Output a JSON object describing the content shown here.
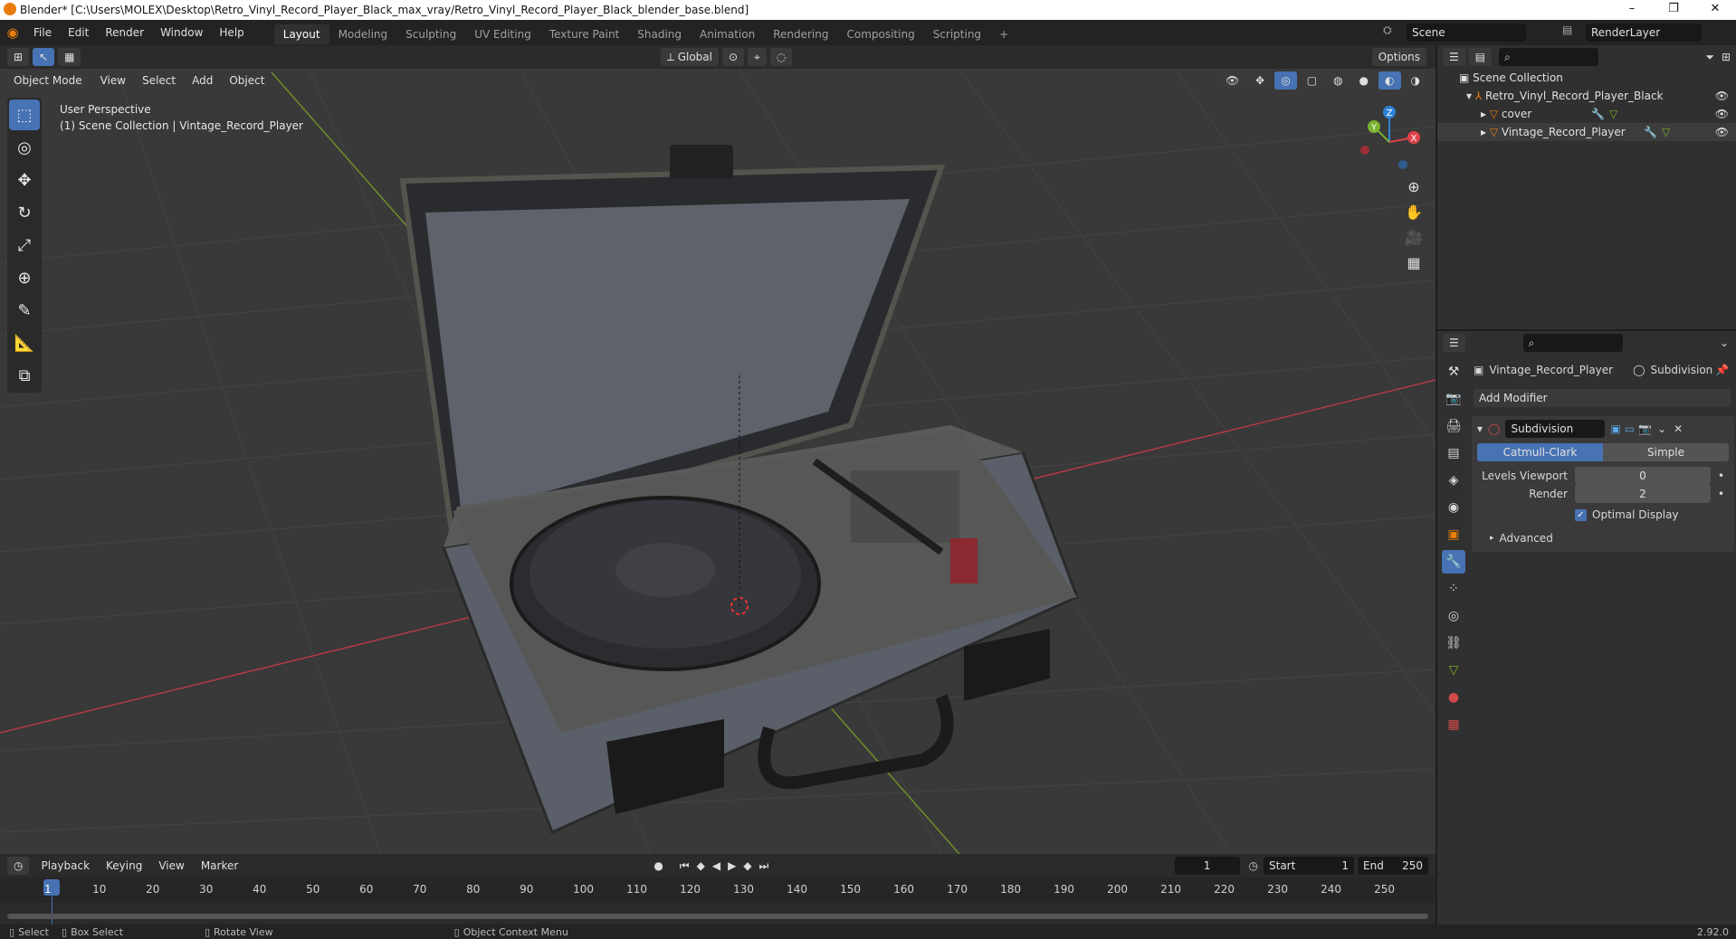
{
  "window": {
    "title": "Blender* [C:\\Users\\MOLEX\\Desktop\\Retro_Vinyl_Record_Player_Black_max_vray/Retro_Vinyl_Record_Player_Black_blender_base.blend]",
    "min_btn": "–",
    "max_btn": "❐",
    "close_btn": "✕"
  },
  "menubar": {
    "menus": [
      "File",
      "Edit",
      "Render",
      "Window",
      "Help"
    ],
    "workspaces": [
      "Layout",
      "Modeling",
      "Sculpting",
      "UV Editing",
      "Texture Paint",
      "Shading",
      "Animation",
      "Rendering",
      "Compositing",
      "Scripting"
    ],
    "add_workspace": "+",
    "scene_label": "Scene",
    "render_layer": "RenderLayer"
  },
  "viewport": {
    "transform_orientation": "Global",
    "options_label": "Options",
    "mode": "Object Mode",
    "menus": [
      "View",
      "Select",
      "Add",
      "Object"
    ],
    "overlay_line1": "User Perspective",
    "overlay_line2": "(1) Scene Collection | Vintage_Record_Player",
    "gizmo": {
      "x": "X",
      "y": "Y",
      "z": "Z"
    }
  },
  "timeline": {
    "menus": [
      "Playback",
      "Keying",
      "View",
      "Marker"
    ],
    "current_frame": "1",
    "start_label": "Start",
    "start": "1",
    "end_label": "End",
    "end": "250",
    "ruler": [
      "1",
      "10",
      "20",
      "30",
      "40",
      "50",
      "60",
      "70",
      "80",
      "90",
      "100",
      "110",
      "120",
      "130",
      "140",
      "150",
      "160",
      "170",
      "180",
      "190",
      "200",
      "210",
      "220",
      "230",
      "240",
      "250"
    ]
  },
  "outliner": {
    "root": "Scene Collection",
    "collection": "Retro_Vinyl_Record_Player_Black",
    "objects": [
      "cover",
      "Vintage_Record_Player"
    ]
  },
  "properties": {
    "object_name": "Vintage_Record_Player",
    "modifier_label": "Subdivision",
    "add_modifier": "Add Modifier",
    "modifier_name": "Subdivision",
    "mode_catmull": "Catmull-Clark",
    "mode_simple": "Simple",
    "levels_viewport_label": "Levels Viewport",
    "levels_viewport": "0",
    "render_label": "Render",
    "render_value": "2",
    "optimal_display": "Optimal Display",
    "advanced": "Advanced"
  },
  "statusbar": {
    "select": "Select",
    "box_select": "Box Select",
    "rotate_view": "Rotate View",
    "context_menu": "Object Context Menu",
    "version": "2.92.0"
  },
  "colors": {
    "accent": "#4772b3",
    "x_axis": "#e0424a",
    "y_axis": "#7ab230",
    "z_axis": "#2f82d9",
    "orange": "#e87d0d"
  }
}
